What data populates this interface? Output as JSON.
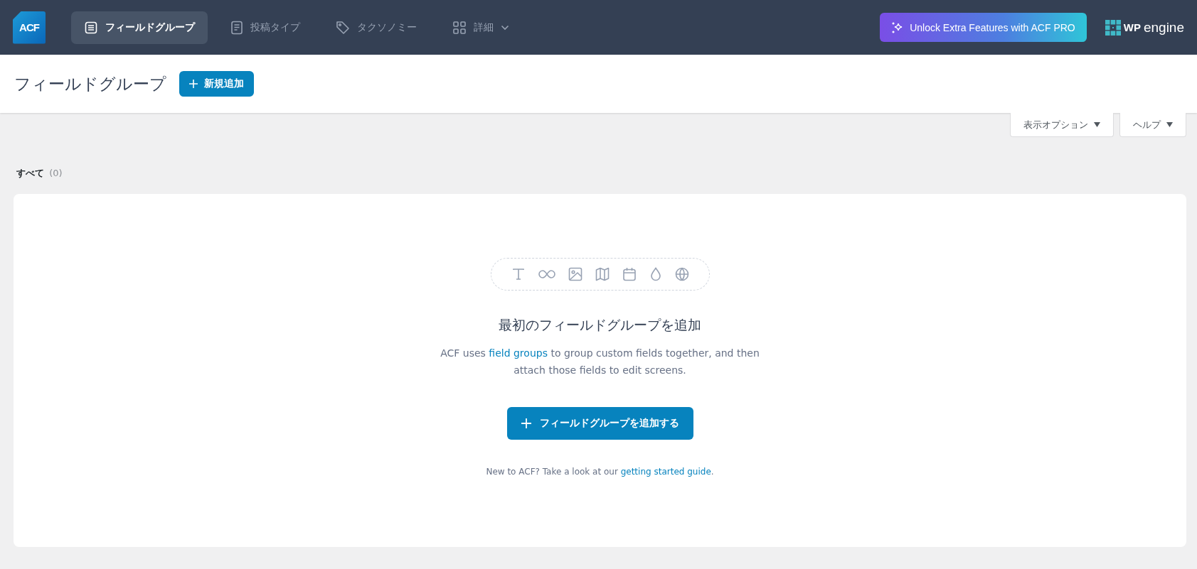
{
  "top_bar": {
    "logo": "ACF",
    "nav": [
      {
        "label": "フィールドグループ",
        "selected": true,
        "kind": "list"
      },
      {
        "label": "投稿タイプ",
        "selected": false,
        "kind": "doc"
      },
      {
        "label": "タクソノミー",
        "selected": false,
        "kind": "tag"
      },
      {
        "label": "詳細",
        "selected": false,
        "kind": "grid"
      }
    ],
    "pro_button": "Unlock Extra Features with ACF PRO",
    "partner_logo": {
      "bold": "WP",
      "light": "engine"
    }
  },
  "header": {
    "title": "フィールドグループ",
    "add_button": "新規追加"
  },
  "screen_options": [
    {
      "label": "表示オプション",
      "expanded": false
    },
    {
      "label": "ヘルプ",
      "expanded": false
    }
  ],
  "filter": {
    "label": "すべて",
    "count": "(0)"
  },
  "empty_state": {
    "heading": "最初のフィールドグループを追加",
    "description": {
      "before": "ACF uses ",
      "link": "field groups",
      "after": " to group custom fields together, and then attach those fields to edit screens."
    },
    "button": "フィールドグループを追加する",
    "footer": {
      "before": "New to ACF? Take a look at our ",
      "link": "getting started guide",
      "after": "."
    }
  }
}
